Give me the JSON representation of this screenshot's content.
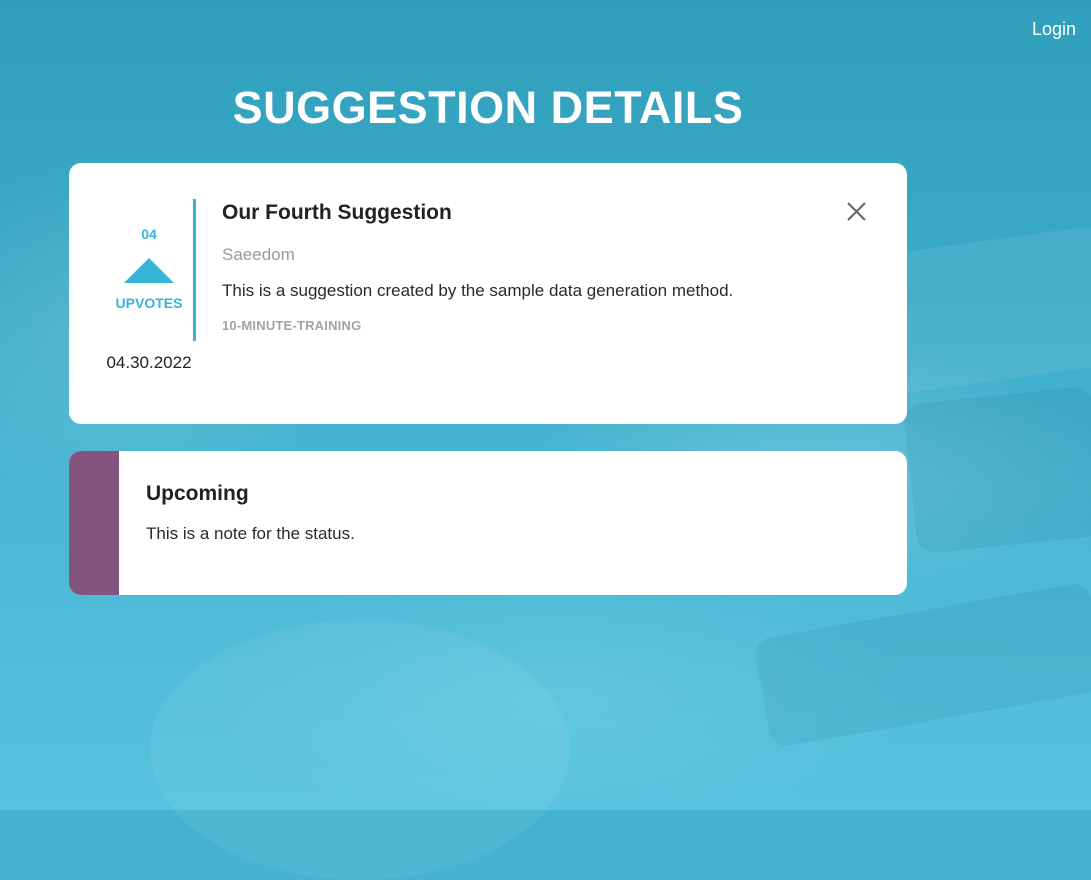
{
  "nav": {
    "login_label": "Login"
  },
  "page": {
    "title": "SUGGESTION DETAILS"
  },
  "suggestion": {
    "vote_count": "04",
    "upvotes_label": "UPVOTES",
    "date": "04.30.2022",
    "title": "Our Fourth Suggestion",
    "author": "Saeedom",
    "description": "This is a suggestion created by the sample data generation method.",
    "category": "10-MINUTE-TRAINING",
    "upvote_icon": "triangle-up-icon",
    "close_icon": "close-icon"
  },
  "status": {
    "name": "Upcoming",
    "note": "This is a note for the status.",
    "color": "#82547e"
  },
  "colors": {
    "accent": "#36b5d6",
    "background": "#43b3cf"
  }
}
